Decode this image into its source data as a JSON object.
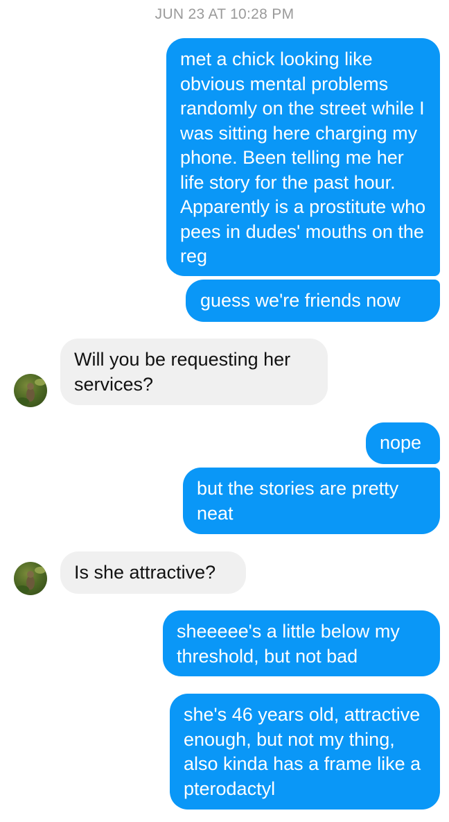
{
  "conversation": {
    "timestamp": "JUN 23 AT 10:28 PM",
    "messages": [
      {
        "direction": "outgoing",
        "text": "met a chick looking like obvious mental problems randomly on the street while I was sitting here charging my phone. Been telling me her life story for the past hour. Apparently is a prostitute who pees in dudes' mouths on the reg"
      },
      {
        "direction": "outgoing",
        "text": "guess we're friends now"
      },
      {
        "direction": "incoming",
        "text": "Will you be requesting her services?"
      },
      {
        "direction": "outgoing",
        "text": "nope"
      },
      {
        "direction": "outgoing",
        "text": "but the stories are pretty neat"
      },
      {
        "direction": "incoming",
        "text": "Is she attractive?"
      },
      {
        "direction": "outgoing",
        "text": "sheeeee's a little below my threshold, but not bad"
      },
      {
        "direction": "outgoing",
        "text": "she's 46 years old, attractive enough, but not my thing, also kinda has a frame like a pterodactyl"
      }
    ]
  },
  "colors": {
    "outgoing_bubble": "#0a97f7",
    "incoming_bubble": "#f0f0f0",
    "timestamp_text": "#9a9a9a"
  },
  "avatar": {
    "icon": "contact-avatar-photo"
  }
}
